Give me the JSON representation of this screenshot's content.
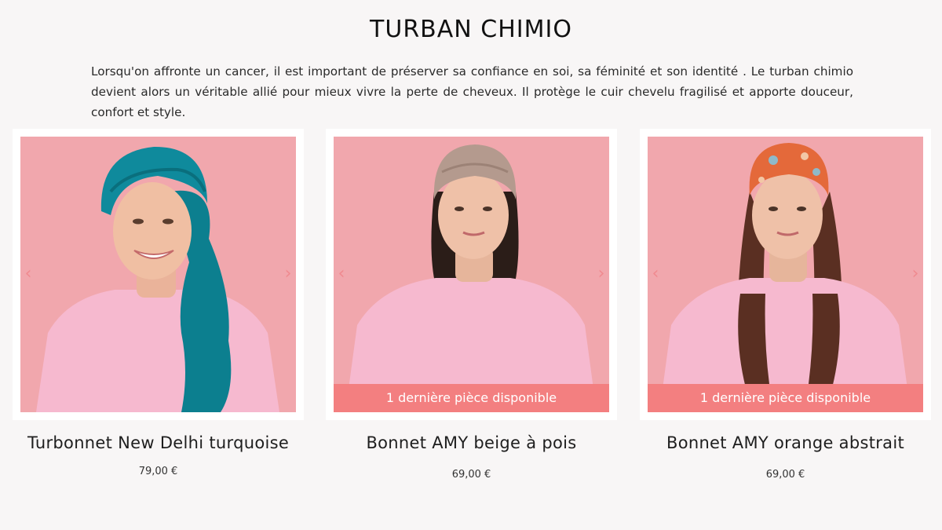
{
  "page": {
    "title": "TURBAN CHIMIO",
    "intro": "Lorsqu'on affronte un cancer, il est important de préserver sa confiance en soi, sa féminité et son identité . Le turban chimio devient alors un véritable allié pour mieux vivre la perte de cheveux. Il protège le cuir chevelu fragilisé et apporte douceur, confort et style."
  },
  "arrows": {
    "prev": "‹",
    "next": "›"
  },
  "products": [
    {
      "name": "Turbonnet New Delhi turquoise",
      "price": "79,00 €",
      "stock_label": "",
      "headwear_color": "#0f8a9c",
      "hair": "none"
    },
    {
      "name": "Bonnet AMY beige à pois",
      "price": "69,00 €",
      "stock_label": "1 dernière pièce disponible",
      "headwear_color": "#b49a8e",
      "hair": "short-dark"
    },
    {
      "name": "Bonnet AMY orange abstrait",
      "price": "69,00 €",
      "stock_label": "1 dernière pièce disponible",
      "headwear_color": "#e4693a",
      "hair": "long-brown"
    }
  ],
  "colors": {
    "background": "#f8f6f6",
    "photo_background": "#f0a9ae",
    "banner": "#f37f80",
    "arrow": "#f08a8f",
    "sweater": "#f6b9cf"
  }
}
